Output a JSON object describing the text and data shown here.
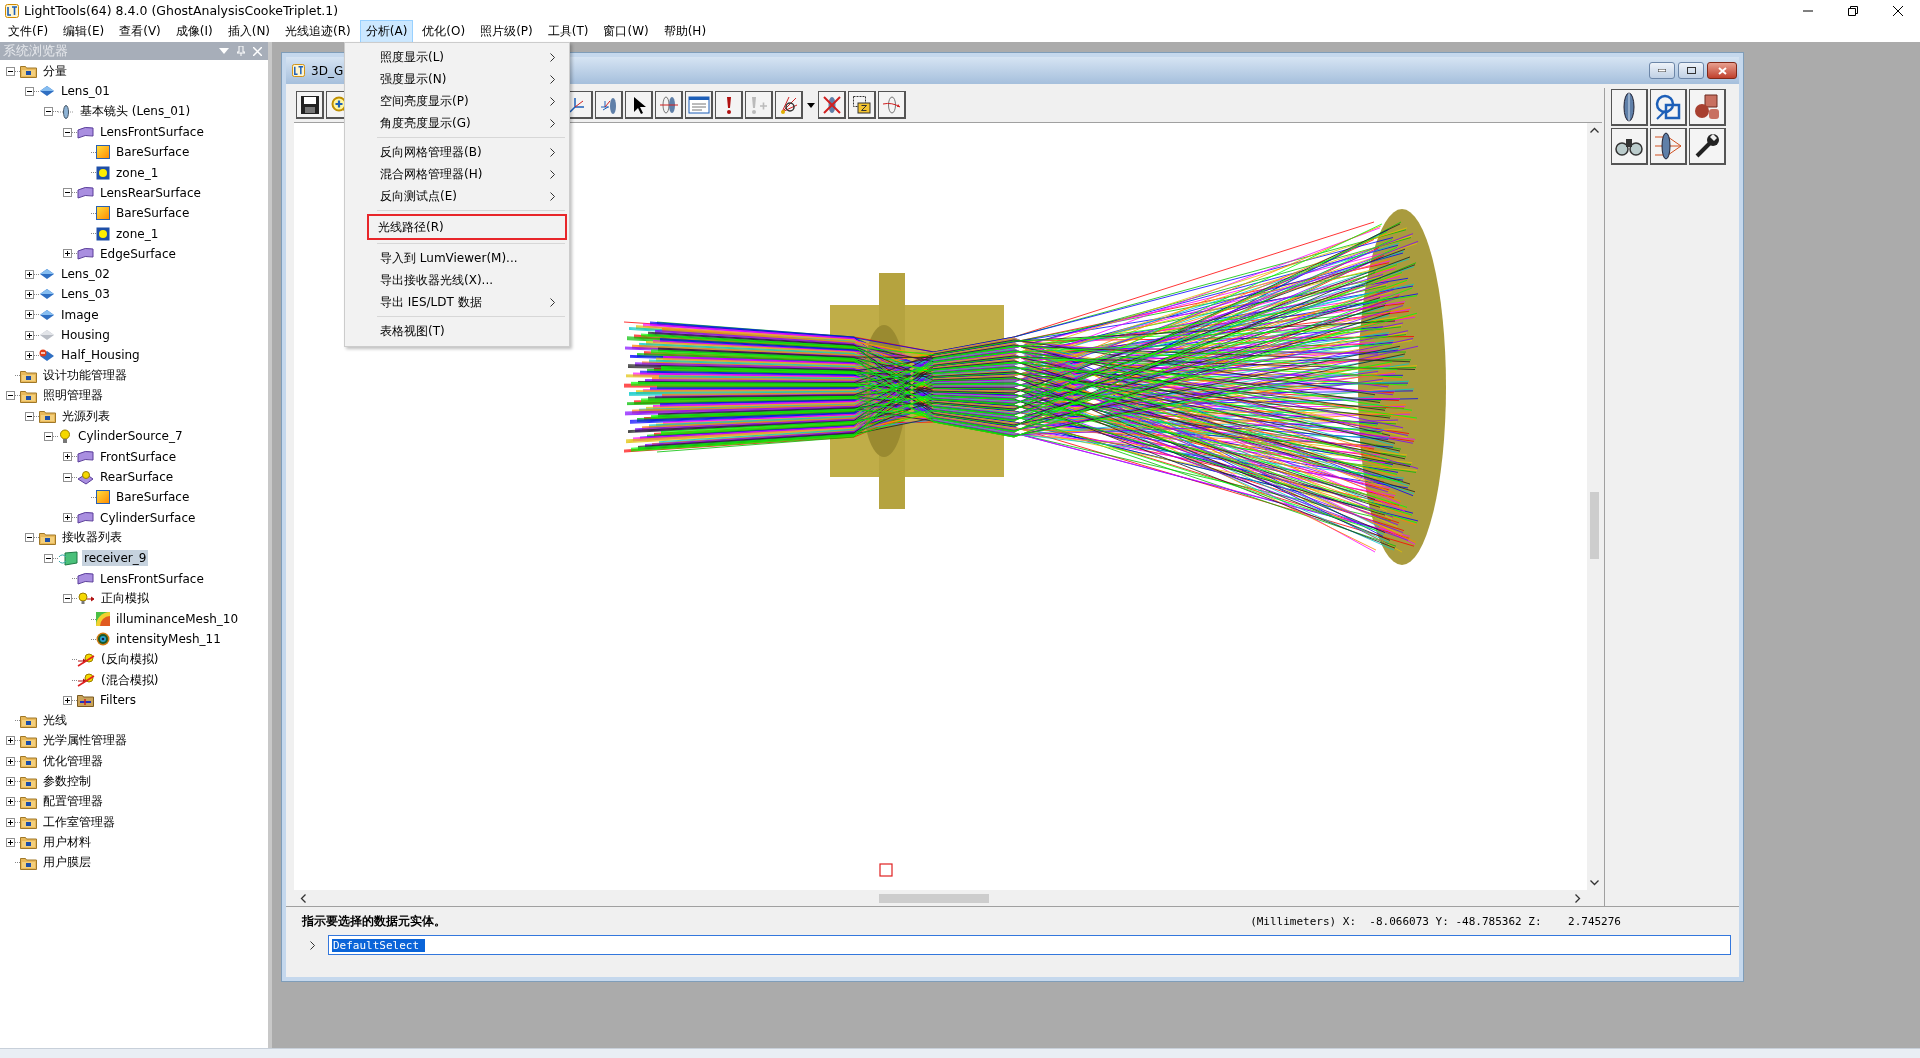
{
  "app_title": "LightTools(64) 8.4.0  (GhostAnalysisCookeTriplet.1)",
  "menu_bar": [
    {
      "label": "文件(F)",
      "selected": false
    },
    {
      "label": "编辑(E)",
      "selected": false
    },
    {
      "label": "查看(V)",
      "selected": false
    },
    {
      "label": "成像(I)",
      "selected": false
    },
    {
      "label": "插入(N)",
      "selected": false
    },
    {
      "label": "光线追迹(R)",
      "selected": false
    },
    {
      "label": "分析(A)",
      "selected": true
    },
    {
      "label": "优化(O)",
      "selected": false
    },
    {
      "label": "照片级(P)",
      "selected": false
    },
    {
      "label": "工具(T)",
      "selected": false
    },
    {
      "label": "窗口(W)",
      "selected": false
    },
    {
      "label": "帮助(H)",
      "selected": false
    }
  ],
  "browser": {
    "title": "系统浏览器",
    "tree": [
      {
        "label": "分量",
        "kind": "folder",
        "expanded": true,
        "selected": false,
        "children": [
          {
            "label": "Lens_01",
            "kind": "lens",
            "expanded": true,
            "selected": false,
            "children": [
              {
                "label": "基本镜头 (Lens_01)",
                "kind": "element",
                "expanded": true,
                "selected": false,
                "children": [
                  {
                    "label": "LensFrontSurface",
                    "kind": "surface",
                    "expanded": true,
                    "selected": false,
                    "children": [
                      {
                        "label": "BareSurface",
                        "kind": "bare",
                        "selected": false
                      },
                      {
                        "label": "zone_1",
                        "kind": "zone",
                        "selected": false
                      }
                    ]
                  },
                  {
                    "label": "LensRearSurface",
                    "kind": "surface",
                    "expanded": true,
                    "selected": false,
                    "children": [
                      {
                        "label": "BareSurface",
                        "kind": "bare",
                        "selected": false
                      },
                      {
                        "label": "zone_1",
                        "kind": "zone",
                        "selected": false
                      }
                    ]
                  },
                  {
                    "label": "EdgeSurface",
                    "kind": "surface",
                    "expanded": false,
                    "selected": false
                  }
                ]
              }
            ]
          },
          {
            "label": "Lens_02",
            "kind": "lens",
            "expanded": false,
            "selected": false
          },
          {
            "label": "Lens_03",
            "kind": "lens",
            "expanded": false,
            "selected": false
          },
          {
            "label": "Image",
            "kind": "lens",
            "expanded": false,
            "selected": false
          },
          {
            "label": "Housing",
            "kind": "lens-grey",
            "expanded": false,
            "selected": false
          },
          {
            "label": "Half_Housing",
            "kind": "lens-blocked",
            "expanded": false,
            "selected": false
          }
        ]
      },
      {
        "label": "设计功能管理器",
        "kind": "folder",
        "selected": false
      },
      {
        "label": "照明管理器",
        "kind": "folder",
        "expanded": true,
        "selected": false,
        "children": [
          {
            "label": "光源列表",
            "kind": "folder",
            "expanded": true,
            "selected": false,
            "children": [
              {
                "label": "CylinderSource_7",
                "kind": "source",
                "expanded": true,
                "selected": false,
                "children": [
                  {
                    "label": "FrontSurface",
                    "kind": "surface",
                    "expanded": false,
                    "selected": false
                  },
                  {
                    "label": "RearSurface",
                    "kind": "source-surface",
                    "expanded": true,
                    "selected": false,
                    "children": [
                      {
                        "label": "BareSurface",
                        "kind": "bare",
                        "selected": false
                      }
                    ]
                  },
                  {
                    "label": "CylinderSurface",
                    "kind": "surface",
                    "expanded": false,
                    "selected": false
                  }
                ]
              }
            ]
          },
          {
            "label": "接收器列表",
            "kind": "folder",
            "expanded": true,
            "selected": false,
            "children": [
              {
                "label": "receiver_9",
                "kind": "receiver",
                "expanded": true,
                "selected": true,
                "children": [
                  {
                    "label": "LensFrontSurface",
                    "kind": "surface",
                    "selected": false
                  },
                  {
                    "label": "正向模拟",
                    "kind": "simulation",
                    "expanded": true,
                    "selected": false,
                    "children": [
                      {
                        "label": "illuminanceMesh_10",
                        "kind": "illuminance",
                        "selected": false
                      },
                      {
                        "label": "intensityMesh_11",
                        "kind": "intensity",
                        "selected": false
                      }
                    ]
                  },
                  {
                    "label": "(反向模拟)",
                    "kind": "simulation-off",
                    "selected": false
                  },
                  {
                    "label": "(混合模拟)",
                    "kind": "simulation-off",
                    "selected": false
                  },
                  {
                    "label": "Filters",
                    "kind": "filters",
                    "expanded": false,
                    "selected": false
                  }
                ]
              }
            ]
          }
        ]
      },
      {
        "label": "光线",
        "kind": "folder",
        "selected": false
      },
      {
        "label": "光学属性管理器",
        "kind": "folder",
        "expanded": false,
        "selected": false
      },
      {
        "label": "优化管理器",
        "kind": "folder",
        "expanded": false,
        "selected": false
      },
      {
        "label": "参数控制",
        "kind": "folder",
        "expanded": false,
        "selected": false
      },
      {
        "label": "配置管理器",
        "kind": "folder",
        "expanded": false,
        "selected": false
      },
      {
        "label": "工作室管理器",
        "kind": "folder",
        "expanded": false,
        "selected": false
      },
      {
        "label": "用户材料",
        "kind": "folder",
        "expanded": false,
        "selected": false
      },
      {
        "label": "用户膜层",
        "kind": "folder",
        "selected": false
      }
    ]
  },
  "analysis_menu": [
    [
      {
        "label": "照度显示(L)",
        "submenu": true,
        "outlined": false
      },
      {
        "label": "强度显示(N)",
        "submenu": true,
        "outlined": false
      },
      {
        "label": "空间亮度显示(P)",
        "submenu": true,
        "outlined": false
      },
      {
        "label": "角度亮度显示(G)",
        "submenu": true,
        "outlined": false
      }
    ],
    [
      {
        "label": "反向网格管理器(B)",
        "submenu": true,
        "outlined": false
      },
      {
        "label": "混合网格管理器(H)",
        "submenu": true,
        "outlined": false
      },
      {
        "label": "反向测试点(E)",
        "submenu": true,
        "outlined": false
      }
    ],
    [
      {
        "label": "光线路径(R)",
        "submenu": false,
        "outlined": true
      }
    ],
    [
      {
        "label": "导入到 LumViewer(M)...",
        "submenu": false,
        "outlined": false
      },
      {
        "label": "导出接收器光线(X)...",
        "submenu": false,
        "outlined": false
      },
      {
        "label": "导出 IES/LDT 数据",
        "submenu": true,
        "outlined": false
      }
    ],
    [
      {
        "label": "表格视图(T)",
        "submenu": false,
        "outlined": false
      }
    ]
  ],
  "document": {
    "title": "3D_G",
    "message": "指示要选择的数据元实体。",
    "coordinates": "(Millimeters) X:  -8.066073 Y: -48.785362 Z:    2.745276",
    "command": "DefaultSelect"
  }
}
